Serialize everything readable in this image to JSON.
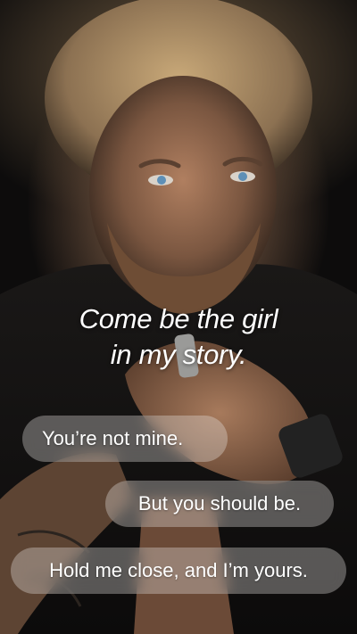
{
  "headline": {
    "line1": "Come be the girl",
    "line2": "in my story."
  },
  "messages": [
    {
      "text": "You’re not mine."
    },
    {
      "text": "But you should be."
    },
    {
      "text": "Hold me close, and I’m yours."
    }
  ],
  "colors": {
    "bubble_fill": "#ebe8e6",
    "text": "#ffffff",
    "background": "#0b0b0c"
  }
}
